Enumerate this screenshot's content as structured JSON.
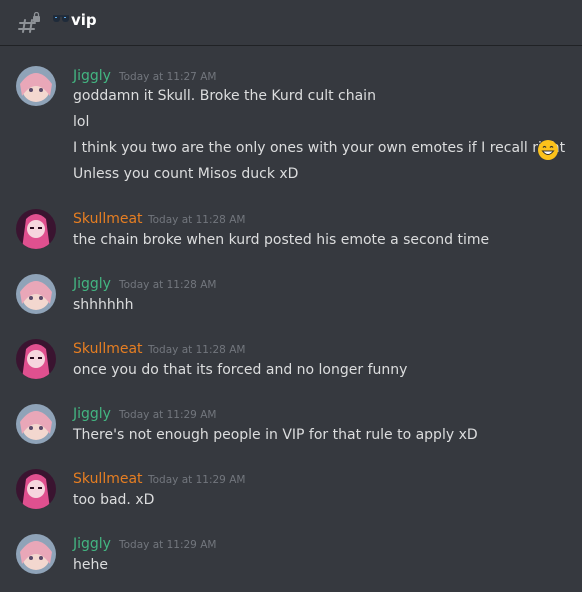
{
  "channel": {
    "icon": "hash-with-lock-icon",
    "emoji": "sunglasses-icon",
    "name": "vip"
  },
  "colors": {
    "background": "#36393f",
    "jiggly": "#43b581",
    "skullmeat": "#e67e22",
    "timestamp": "#72767d",
    "text": "#dcddde"
  },
  "messages": [
    {
      "author": "Jiggly",
      "timestamp": "Today at 11:27 AM",
      "lines": [
        "goddamn it Skull. Broke the Kurd cult chain",
        "lol",
        "I think you two are the only ones with your own emotes if I recall right",
        "Unless you count Misos duck xD"
      ],
      "inline_emoji": "grinning-face-icon"
    },
    {
      "author": "Skullmeat",
      "timestamp": "Today at 11:28 AM",
      "lines": [
        "the chain broke when kurd posted his emote a second time"
      ]
    },
    {
      "author": "Jiggly",
      "timestamp": "Today at 11:28 AM",
      "lines": [
        "shhhhhh"
      ]
    },
    {
      "author": "Skullmeat",
      "timestamp": "Today at 11:28 AM",
      "lines": [
        "once you do that its forced and no longer funny"
      ]
    },
    {
      "author": "Jiggly",
      "timestamp": "Today at 11:29 AM",
      "lines": [
        "There's not enough people in VIP for that rule to apply xD"
      ]
    },
    {
      "author": "Skullmeat",
      "timestamp": "Today at 11:29 AM",
      "lines": [
        "too bad. xD"
      ]
    },
    {
      "author": "Jiggly",
      "timestamp": "Today at 11:29 AM",
      "lines": [
        "hehe"
      ]
    }
  ]
}
